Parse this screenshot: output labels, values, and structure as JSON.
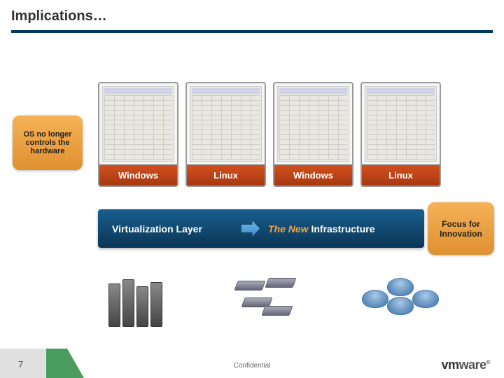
{
  "title": "Implications…",
  "callout_left": "OS no longer controls the hardware",
  "callout_right": "Focus for Innovation",
  "vms": [
    {
      "label": "Windows"
    },
    {
      "label": "Linux"
    },
    {
      "label": "Windows"
    },
    {
      "label": "Linux"
    }
  ],
  "virt": {
    "label": "Virtualization Layer",
    "highlight": "The New",
    "rest": " Infrastructure"
  },
  "footer": {
    "page": "7",
    "conf": "Confidential",
    "logo_vm": "vm",
    "logo_ware": "ware",
    "logo_tm": "®"
  }
}
